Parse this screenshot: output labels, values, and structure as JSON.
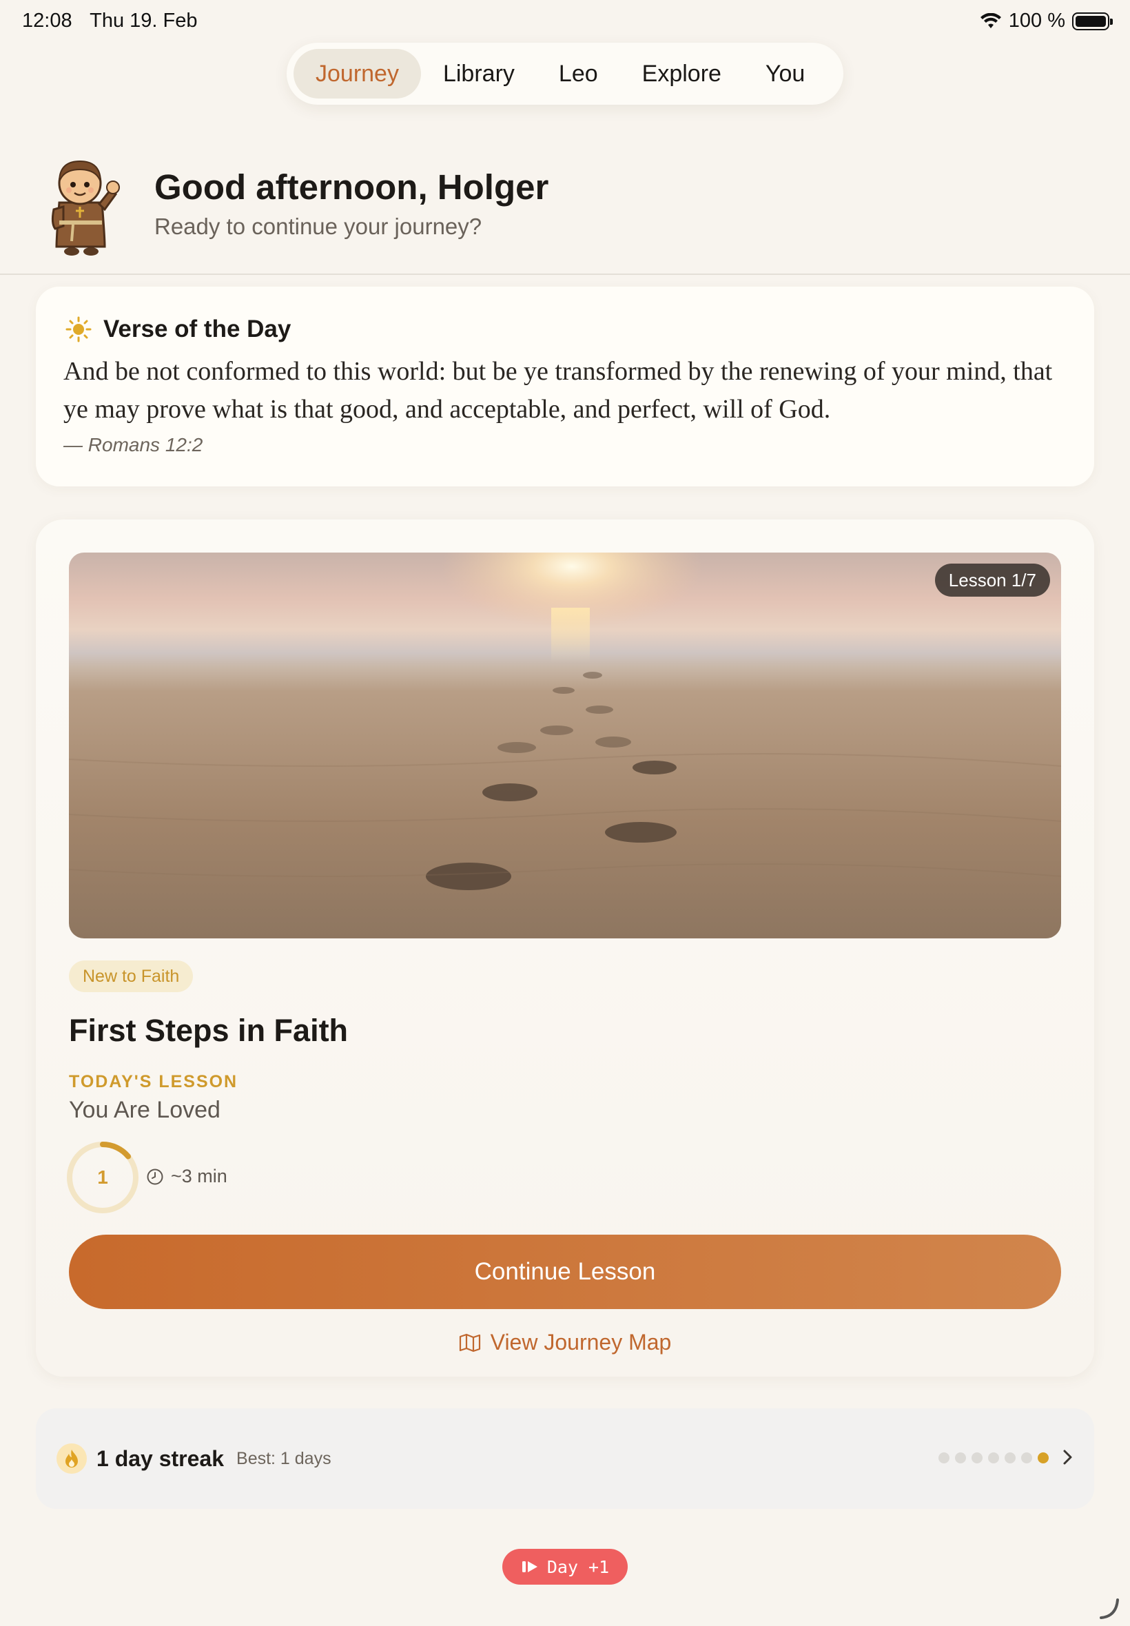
{
  "status_bar": {
    "time": "12:08",
    "date": "Thu 19. Feb",
    "battery": "100 %"
  },
  "nav": {
    "tabs": [
      "Journey",
      "Library",
      "Leo",
      "Explore",
      "You"
    ],
    "active": "Journey"
  },
  "greeting": {
    "title": "Good afternoon, Holger",
    "subtitle": "Ready to continue your journey?"
  },
  "verse": {
    "heading": "Verse of the Day",
    "text": "And be not conformed to this world: but be ye transformed by the renewing of your mind, that ye may prove what is that good, and acceptable, and perfect, will of God.",
    "reference": "— Romans 12:2"
  },
  "lesson": {
    "badge": "Lesson 1/7",
    "tag": "New to Faith",
    "title": "First Steps in Faith",
    "today_label": "TODAY'S LESSON",
    "today_name": "You Are Loved",
    "progress_number": "1",
    "progress_fraction": 0.14,
    "duration": "~3 min",
    "continue_label": "Continue Lesson",
    "map_label": "View Journey Map"
  },
  "streak": {
    "label": "1 day streak",
    "best": "Best: 1 days",
    "days_total": 7,
    "days_active": 1
  },
  "debug": {
    "day_label": "Day +1"
  },
  "colors": {
    "accent": "#c0672e",
    "gold": "#d39b2f",
    "background": "#f8f4ee",
    "pill": "#ef5f5f"
  }
}
